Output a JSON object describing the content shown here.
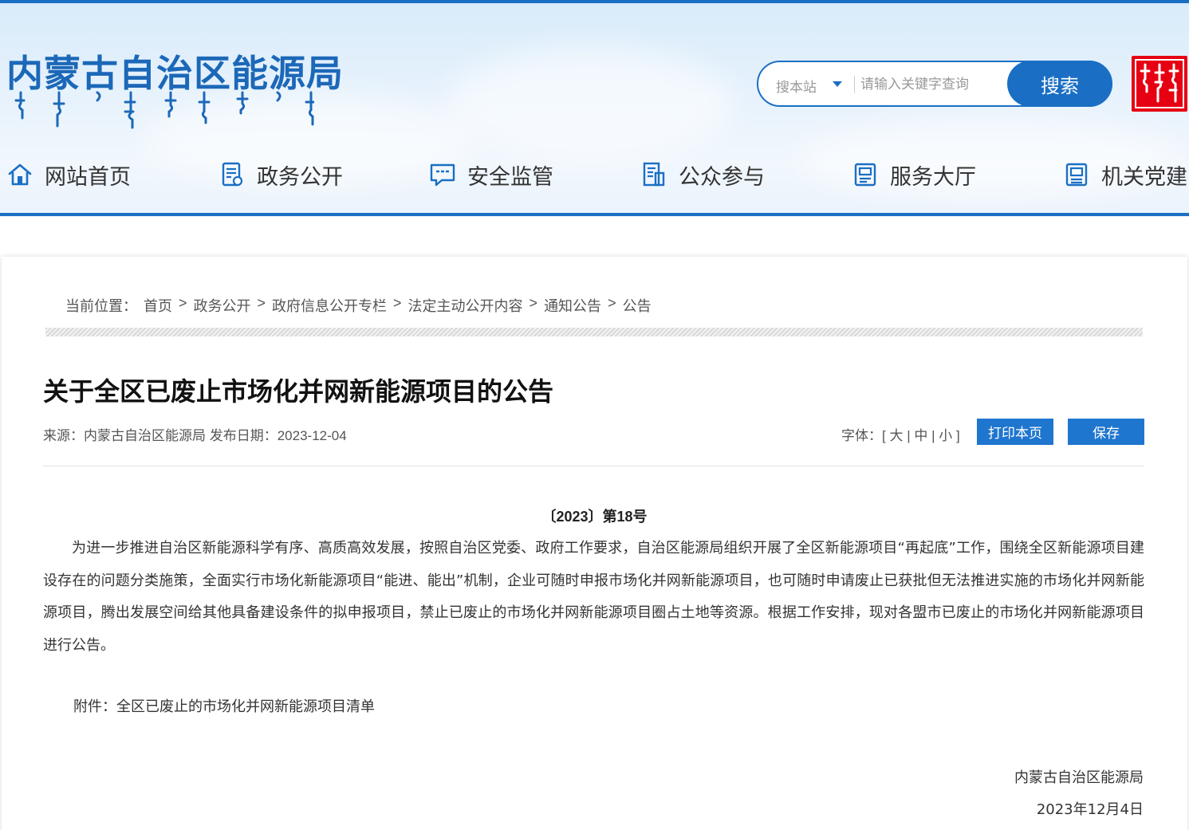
{
  "header": {
    "site_name": "内蒙古自治区能源局",
    "search": {
      "scope_label": "搜本站",
      "placeholder": "请输入关键字查询",
      "button_label": "搜索"
    }
  },
  "nav": {
    "items": [
      {
        "label": "网站首页",
        "icon": "home-icon"
      },
      {
        "label": "政务公开",
        "icon": "document-icon"
      },
      {
        "label": "安全监管",
        "icon": "chat-icon"
      },
      {
        "label": "公众参与",
        "icon": "form-icon"
      },
      {
        "label": "服务大厅",
        "icon": "service-icon"
      },
      {
        "label": "机关党建",
        "icon": "party-icon"
      }
    ]
  },
  "breadcrumb": {
    "prefix": "当前位置：",
    "items": [
      "首页",
      "政务公开",
      "政府信息公开专栏",
      "法定主动公开内容",
      "通知公告",
      "公告"
    ],
    "separator": ">"
  },
  "article": {
    "title": "关于全区已废止市场化并网新能源项目的公告",
    "meta": "来源：内蒙古自治区能源局 发布日期：2023-12-04",
    "font_size": {
      "label": "字体：",
      "open": "[",
      "large": "大",
      "medium": "中",
      "small": "小",
      "close": "]",
      "divider": "|"
    },
    "print_label": "打印本页",
    "save_label": "保存",
    "doc_number": "〔2023〕第18号",
    "body": "为进一步推进自治区新能源科学有序、高质高效发展，按照自治区党委、政府工作要求，自治区能源局组织开展了全区新能源项目“再起底”工作，围绕全区新能源项目建设存在的问题分类施策，全面实行市场化新能源项目“能进、能出”机制，企业可随时申报市场化并网新能源项目，也可随时申请废止已获批但无法推进实施的市场化并网新能源项目，腾出发展空间给其他具备建设条件的拟申报项目，禁止已废止的市场化并网新能源项目圈占土地等资源。根据工作安排，现对各盟市已废止的市场化并网新能源项目进行公告。",
    "attachment": "附件：全区已废止的市场化并网新能源项目清单",
    "sign_org": "内蒙古自治区能源局",
    "sign_date": "2023年12月4日"
  },
  "colors": {
    "brand": "#1a6fc4",
    "button": "#1f76cf",
    "seal": "#e60012"
  }
}
